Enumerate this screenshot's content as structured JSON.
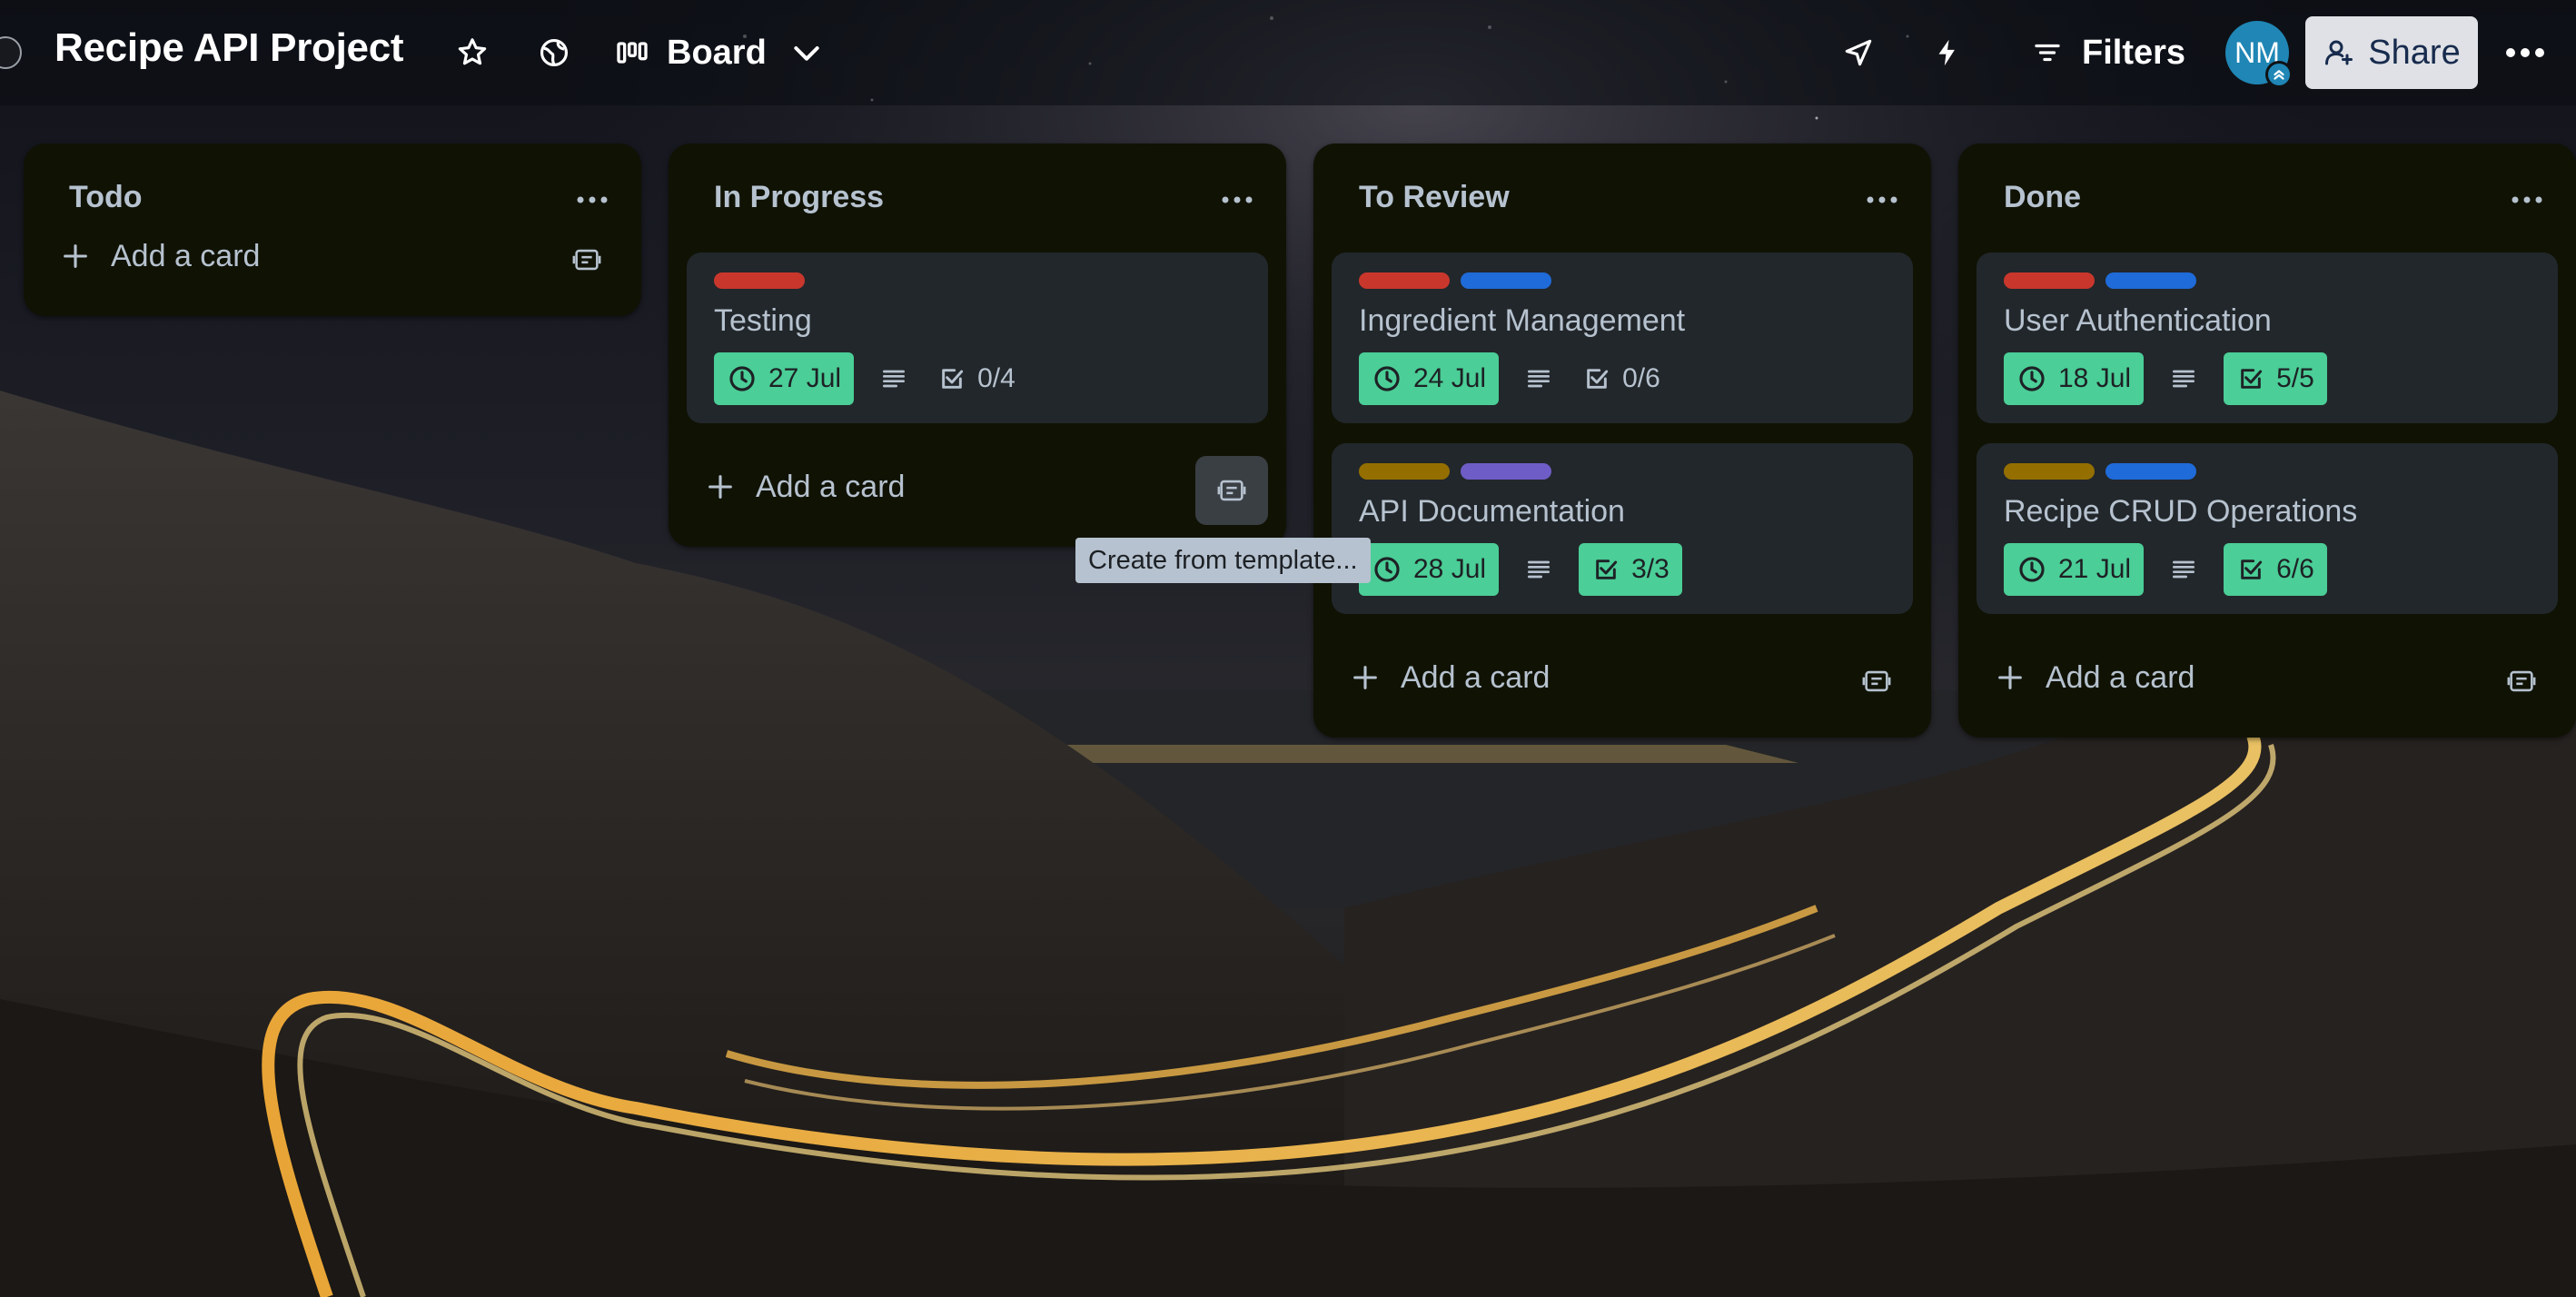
{
  "board": {
    "title": "Recipe API Project",
    "view_label": "Board",
    "filters_label": "Filters",
    "avatar_initials": "NM",
    "share_label": "Share"
  },
  "colors": {
    "due_green": "#4bce97",
    "label_red": "#c9372c",
    "label_blue": "#1f6bd9",
    "label_yellow": "#946f00",
    "label_purple": "#6e5dc6",
    "list_bg": "#101204",
    "card_bg": "#22272b"
  },
  "lists": [
    {
      "title": "Todo",
      "cards": [],
      "add_card_label": "Add a card"
    },
    {
      "title": "In Progress",
      "cards": [
        {
          "title": "Testing",
          "labels": [
            "red"
          ],
          "due": "27 Jul",
          "has_description": true,
          "checklist": "0/4",
          "checklist_complete": false
        }
      ],
      "add_card_label": "Add a card"
    },
    {
      "title": "To Review",
      "cards": [
        {
          "title": "Ingredient Management",
          "labels": [
            "red",
            "blue"
          ],
          "due": "24 Jul",
          "has_description": true,
          "checklist": "0/6",
          "checklist_complete": false
        },
        {
          "title": "API Documentation",
          "labels": [
            "yellow",
            "purple"
          ],
          "due": "28 Jul",
          "has_description": true,
          "checklist": "3/3",
          "checklist_complete": true
        }
      ],
      "add_card_label": "Add a card"
    },
    {
      "title": "Done",
      "cards": [
        {
          "title": "User Authentication",
          "labels": [
            "red",
            "blue"
          ],
          "due": "18 Jul",
          "has_description": true,
          "checklist": "5/5",
          "checklist_complete": true
        },
        {
          "title": "Recipe CRUD Operations",
          "labels": [
            "yellow",
            "blue"
          ],
          "due": "21 Jul",
          "has_description": true,
          "checklist": "6/6",
          "checklist_complete": true
        }
      ],
      "add_card_label": "Add a card"
    }
  ],
  "tooltip": "Create from template..."
}
